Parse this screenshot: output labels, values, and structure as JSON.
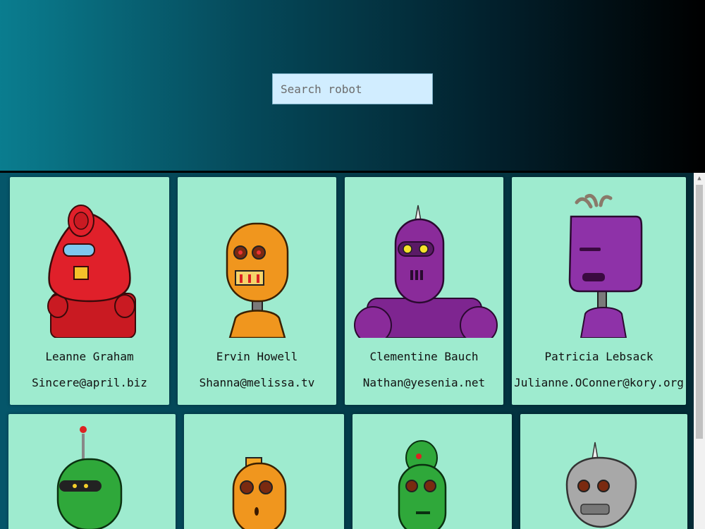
{
  "search": {
    "placeholder": "Search robot"
  },
  "robots": [
    {
      "name": "Leanne Graham",
      "email": "Sincere@april.biz"
    },
    {
      "name": "Ervin Howell",
      "email": "Shanna@melissa.tv"
    },
    {
      "name": "Clementine Bauch",
      "email": "Nathan@yesenia.net"
    },
    {
      "name": "Patricia Lebsack",
      "email": "Julianne.OConner@kory.org"
    },
    {
      "name": "",
      "email": ""
    },
    {
      "name": "",
      "email": ""
    },
    {
      "name": "",
      "email": ""
    },
    {
      "name": "",
      "email": ""
    }
  ],
  "colors": {
    "card_bg": "#9eebcf",
    "search_bg": "#d1edff",
    "robot_1": "#e0202a",
    "robot_2": "#f0961e",
    "robot_3": "#8a2b9a",
    "robot_4": "#8e32a8",
    "robot_5": "#2fa83a",
    "robot_6": "#f0961e",
    "robot_7": "#2fa83a",
    "robot_8": "#a8a8a8"
  },
  "icons": [
    "robot-avatar-icon"
  ]
}
